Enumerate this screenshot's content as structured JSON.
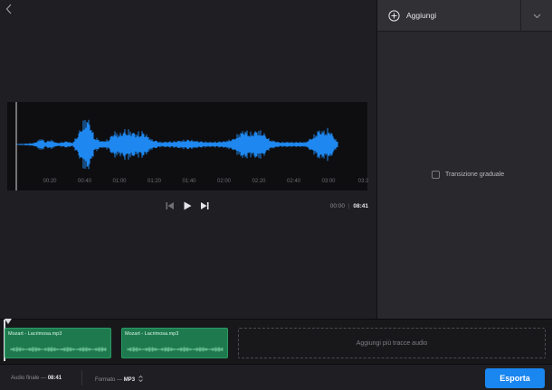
{
  "editor": {
    "back_icon": "chevron-left-icon",
    "wave_color": "#1e88f0",
    "time_ticks": [
      "00:20",
      "00:40",
      "01:00",
      "01:20",
      "01:40",
      "02:00",
      "02:20",
      "02:40",
      "03:00",
      "03:2"
    ],
    "current_time": "00:00",
    "separator": "|",
    "total_time": "08:41",
    "prev_icon": "skip-back-icon",
    "play_icon": "play-icon",
    "next_icon": "skip-forward-icon"
  },
  "sidebar": {
    "add_icon": "plus-circle-icon",
    "add_label": "Aggiungi",
    "dropdown_icon": "chevron-down-icon",
    "fade_label": "Transizione graduale",
    "fade_checked": false
  },
  "timeline": {
    "clip_color": "#1e7a4e",
    "clips": [
      {
        "name": "Mozart - Lacrimosa.mp3"
      },
      {
        "name": "Mozart - Lacrimosa.mp3"
      }
    ],
    "add_more_label": "Aggiungi più tracce audio"
  },
  "footer": {
    "final_audio_label": "Audio finale —",
    "final_audio_value": "08:41",
    "format_label": "Formato —",
    "format_value": "MP3",
    "format_icon": "chevron-updown-icon",
    "export_label": "Esporta",
    "export_color": "#1a86f0"
  }
}
